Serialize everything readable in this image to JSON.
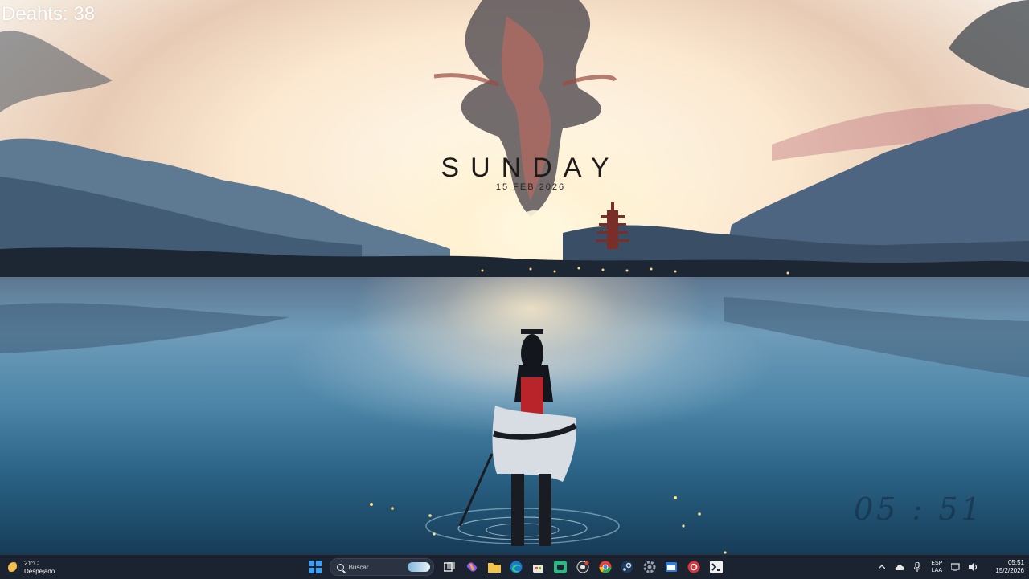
{
  "overlay": {
    "deaths": "Deahts: 38",
    "day": "SUNDAY",
    "date": "15 FEB 2026"
  },
  "wallpaper": {
    "clock_signature": "05 : 51"
  },
  "taskbar": {
    "weather": {
      "temperature": "21°C",
      "condition": "Despejado",
      "icon": "moon-icon"
    },
    "search": {
      "placeholder": "Buscar"
    },
    "pinned": [
      {
        "name": "start-button",
        "icon": "windows-logo",
        "color": "#3aa0f3"
      },
      {
        "name": "task-view",
        "icon": "task-view-icon",
        "color": "#e6e6e6"
      },
      {
        "name": "copilot",
        "icon": "copilot-icon",
        "color": "#8a5cf6"
      },
      {
        "name": "file-explorer",
        "icon": "folder-icon",
        "color": "#f3c447"
      },
      {
        "name": "edge",
        "icon": "edge-icon",
        "color": "#1fa37a"
      },
      {
        "name": "store",
        "icon": "store-icon",
        "color": "#e6e6e6"
      },
      {
        "name": "xbox",
        "icon": "xbox-icon",
        "color": "#2fb783"
      },
      {
        "name": "github",
        "icon": "github-icon",
        "color": "#e6e6e6"
      },
      {
        "name": "chrome",
        "icon": "chrome-icon",
        "color": "#e94235"
      },
      {
        "name": "steam",
        "icon": "steam-icon",
        "color": "#6aa7d8"
      },
      {
        "name": "settings",
        "icon": "gear-icon",
        "color": "#9aa3b2"
      },
      {
        "name": "app-blue",
        "icon": "window-icon",
        "color": "#2f7fd6"
      },
      {
        "name": "app-red",
        "icon": "red-circle-icon",
        "color": "#d9343a"
      },
      {
        "name": "app-dark",
        "icon": "app-icon",
        "color": "#e6e6e6"
      }
    ],
    "tray": {
      "language_top": "ESP",
      "language_bottom": "LAA",
      "time": "05:51",
      "date": "15/2/2026"
    }
  }
}
